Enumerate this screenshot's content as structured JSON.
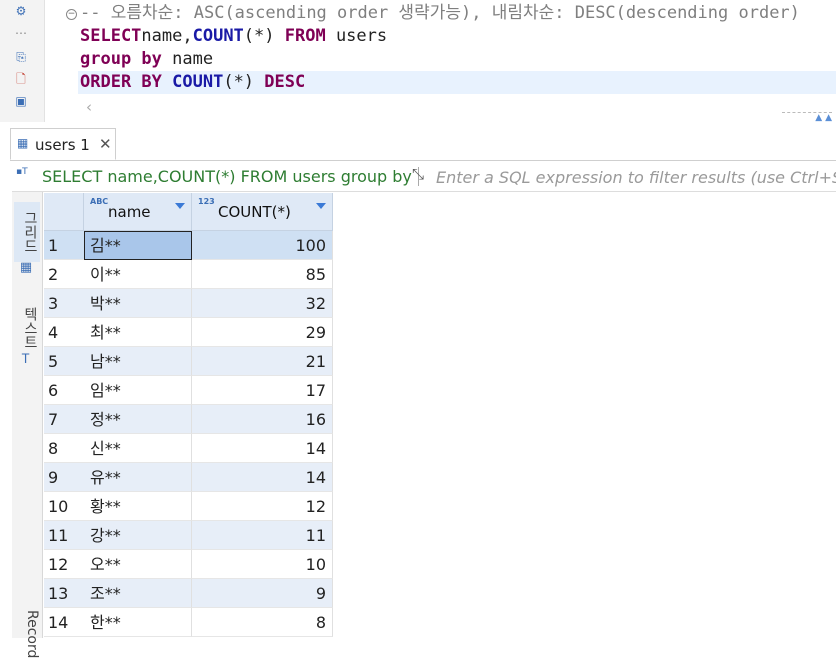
{
  "editor": {
    "lines": [
      {
        "cls": "cm",
        "text": "-- 오름차순: ASC(ascending order 생략가능), 내림차순: DESC(descending order)"
      },
      {
        "parts": [
          [
            "kw",
            "SELECT"
          ],
          [
            "",
            "name,"
          ],
          [
            "fn",
            "COUNT"
          ],
          [
            "",
            "(*) "
          ],
          [
            "kw",
            "FROM"
          ],
          [
            "",
            " users"
          ]
        ]
      },
      {
        "parts": [
          [
            "kw",
            "group by"
          ],
          [
            "",
            " name"
          ]
        ]
      },
      {
        "parts": [
          [
            "kw",
            "ORDER BY"
          ],
          [
            "",
            " "
          ],
          [
            "fn",
            "COUNT"
          ],
          [
            "",
            "(*) "
          ],
          [
            "kw",
            "DESC"
          ]
        ]
      }
    ]
  },
  "tab": {
    "label": "users 1",
    "close": "✕"
  },
  "filter": {
    "query": "SELECT name,COUNT(*) FROM users group by name ORDER BY COUNT(*) DESC",
    "placeholder": "Enter a SQL expression to filter results (use Ctrl+Space)"
  },
  "side_tabs": {
    "grid": "그리드",
    "text": "텍스트",
    "record": "Record"
  },
  "grid": {
    "columns": [
      {
        "type": "ABC",
        "label": "name"
      },
      {
        "type": "123",
        "label": "COUNT(*)"
      }
    ],
    "rows": [
      {
        "num": "1",
        "name": "김**",
        "count": "100"
      },
      {
        "num": "2",
        "name": "이**",
        "count": "85"
      },
      {
        "num": "3",
        "name": "박**",
        "count": "32"
      },
      {
        "num": "4",
        "name": "최**",
        "count": "29"
      },
      {
        "num": "5",
        "name": "남**",
        "count": "21"
      },
      {
        "num": "6",
        "name": "임**",
        "count": "17"
      },
      {
        "num": "7",
        "name": "정**",
        "count": "16"
      },
      {
        "num": "8",
        "name": "신**",
        "count": "14"
      },
      {
        "num": "9",
        "name": "유**",
        "count": "14"
      },
      {
        "num": "10",
        "name": "황**",
        "count": "12"
      },
      {
        "num": "11",
        "name": "강**",
        "count": "11"
      },
      {
        "num": "12",
        "name": "오**",
        "count": "10"
      },
      {
        "num": "13",
        "name": "조**",
        "count": "9"
      },
      {
        "num": "14",
        "name": "한**",
        "count": "8"
      }
    ]
  },
  "colors": {
    "accent": "#3b7ad6",
    "keyword": "#7f0055",
    "function": "#1a1aa6",
    "comment": "#7f7f7f",
    "filter_query": "#2e7d32"
  }
}
